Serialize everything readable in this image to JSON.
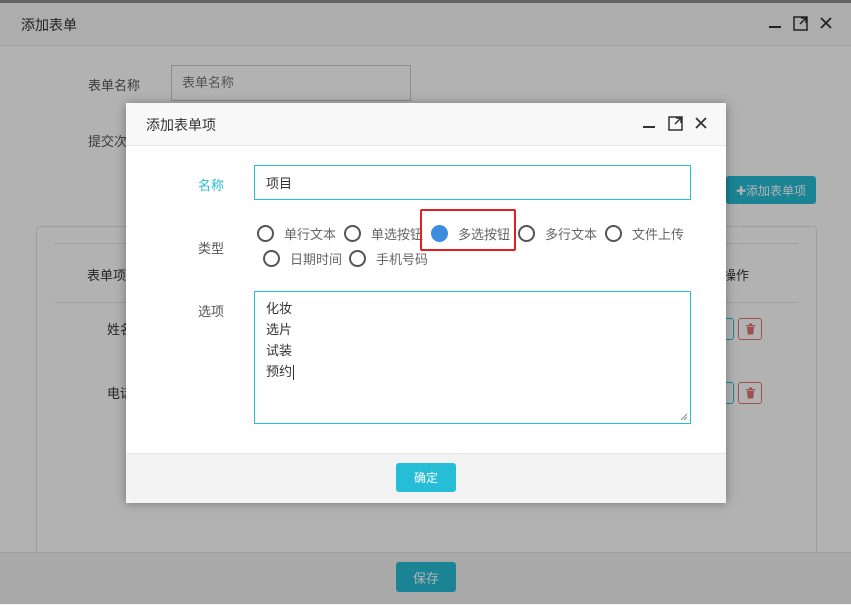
{
  "outer": {
    "title": "添加表单",
    "form_name_label": "表单名称",
    "form_name_placeholder": "表单名称",
    "submit_label": "提交次",
    "add_item_button": "✚添加表单项",
    "table": {
      "col_item": "表单项",
      "col_action": "操作",
      "rows": [
        {
          "name": "姓名"
        },
        {
          "name": "电话"
        }
      ]
    },
    "save_button": "保存"
  },
  "dialog": {
    "title": "添加表单项",
    "name_label": "名称",
    "name_value": "项目",
    "type_label": "类型",
    "types": [
      "单行文本",
      "单选按钮",
      "多选按钮",
      "多行文本",
      "文件上传",
      "日期时间",
      "手机号码"
    ],
    "selected_type": "多选按钮",
    "options_label": "选项",
    "options": [
      "化妆",
      "选片",
      "试装",
      "预约"
    ],
    "ok_button": "确定"
  },
  "colors": {
    "accent": "#26bdd6",
    "radio_selected": "#3c8dde",
    "highlight": "#e02020",
    "delete": "#e57373"
  },
  "icons": [
    "minimize-icon",
    "maximize-icon",
    "close-icon",
    "plus-icon",
    "edit-icon",
    "trash-icon"
  ]
}
